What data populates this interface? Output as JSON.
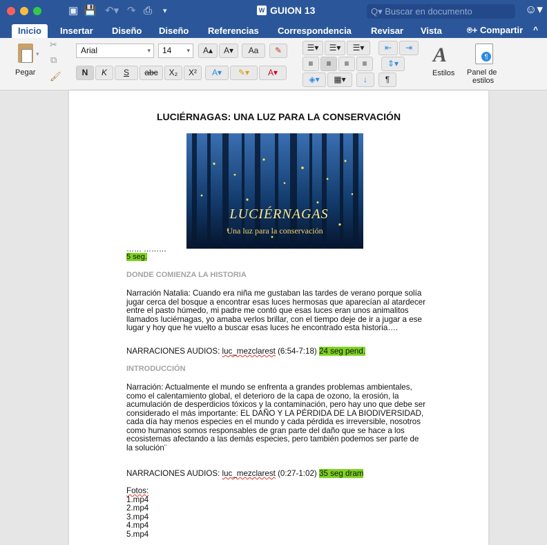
{
  "window": {
    "title": "GUION 13",
    "search_placeholder": "Buscar en documento"
  },
  "tabs": [
    "Inicio",
    "Insertar",
    "Diseño",
    "Diseño",
    "Referencias",
    "Correspondencia",
    "Revisar",
    "Vista"
  ],
  "share_label": "Compartir",
  "ribbon": {
    "paste_label": "Pegar",
    "font_name": "Arial",
    "font_size": "14",
    "bold": "N",
    "italic": "K",
    "underline": "S",
    "strike": "abc",
    "subscript": "X₂",
    "superscript": "X²",
    "grow": "A▴",
    "shrink": "A▾",
    "case": "Aa",
    "styles_label": "Estilos",
    "panel_label_line1": "Panel de",
    "panel_label_line2": "estilos"
  },
  "document": {
    "title": "LUCIÉRNAGAS: UNA LUZ PARA LA CONSERVACIÓN",
    "image_title": "LUCIÉRNAGAS",
    "image_subtitle": "Una luz para la conservación",
    "dots": "…… ………",
    "duration_1": "5 seg.",
    "section_1": "DONDE COMIENZA LA HISTORIA",
    "paragraph_1": [
      "Narración Natalia: Cuando era niña me gustaban las tardes de verano porque solía",
      "jugar cerca del bosque a encontrar esas luces hermosas que aparecían al atardecer",
      "entre el pasto húmedo, mi padre me contó que esas luces eran unos animalitos",
      "llamados luciérnagas, yo amaba verlos brillar, con el tiempo deje de ir a jugar a ese",
      "lugar y hoy que he vuelto a buscar esas luces he encontrado esta historia…."
    ],
    "narr_1": {
      "label": "NARRACIONES AUDIOS: ",
      "file": "luc_mezclarest",
      "time": " (6:54-7:18) ",
      "tag": "24 seg pend."
    },
    "section_2": "INTRODUCCIÓN",
    "paragraph_2": [
      "Narración: Actualmente el mundo se enfrenta a grandes problemas ambientales,",
      "como el calentamiento global, el deterioro de la capa de ozono, la erosión, la",
      "acumulación de desperdicios tóxicos y la contaminación, pero hay uno que debe ser",
      "considerado el más importante: EL DAÑO Y LA PÉRDIDA DE LA BIODIVERSIDAD,",
      "cada día hay menos especies en el mundo y cada pérdida es irreversible, nosotros",
      "como humanos somos responsables de gran parte del daño que se hace a los",
      "ecosistemas afectando a las demás especies, pero también podemos ser parte de",
      "la solución¨"
    ],
    "narr_2": {
      "label": "NARRACIONES AUDIOS: ",
      "file": "luc_mezclarest",
      "time": " (0:27-1:02) ",
      "tag": "35 seg dram"
    },
    "fotos_label": "Fotos:",
    "fotos": [
      "1.mp4",
      "2.mp4",
      "3.mp4",
      "4.mp4",
      "5.mp4"
    ]
  },
  "colors": {
    "word_blue": "#2b579a",
    "highlight_green": "#7ed321"
  }
}
